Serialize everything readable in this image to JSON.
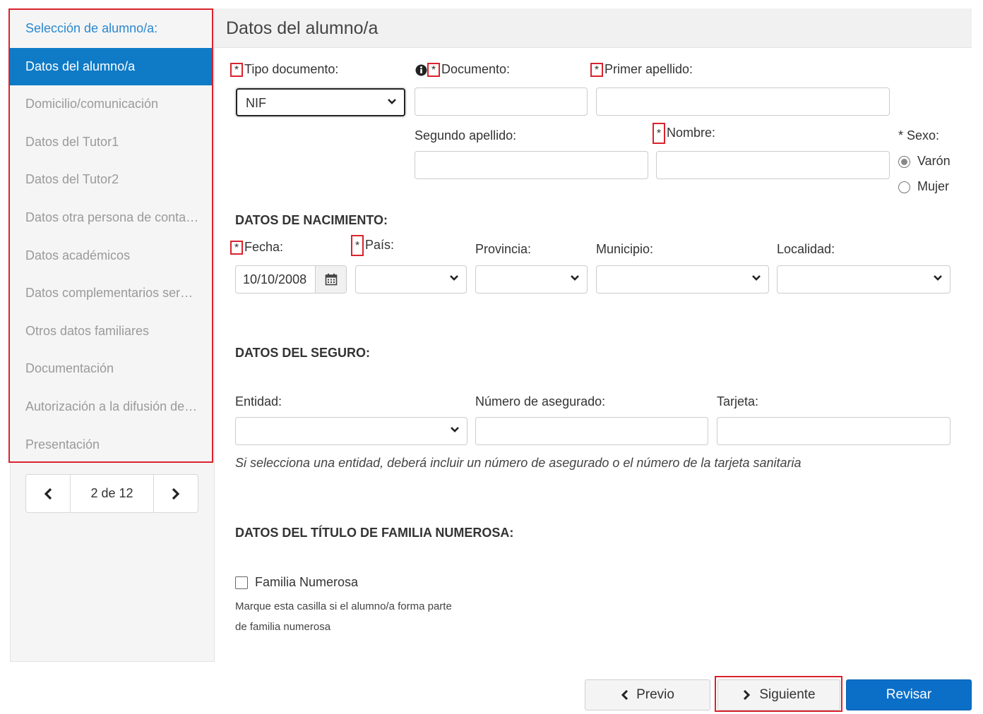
{
  "sidebar": {
    "items": [
      {
        "label": "Selección de alumno/a:",
        "state": "link"
      },
      {
        "label": "Datos del alumno/a",
        "state": "active"
      },
      {
        "label": "Domicilio/comunicación",
        "state": "disabled"
      },
      {
        "label": "Datos del Tutor1",
        "state": "disabled"
      },
      {
        "label": "Datos del Tutor2",
        "state": "disabled"
      },
      {
        "label": "Datos otra persona de contacto",
        "state": "disabled"
      },
      {
        "label": "Datos académicos",
        "state": "disabled"
      },
      {
        "label": "Datos complementarios servicios",
        "state": "disabled"
      },
      {
        "label": "Otros datos familiares",
        "state": "disabled"
      },
      {
        "label": "Documentación",
        "state": "disabled"
      },
      {
        "label": "Autorización a la difusión de imágenes",
        "state": "disabled"
      },
      {
        "label": "Presentación",
        "state": "disabled"
      }
    ]
  },
  "pager": {
    "text": "2 de 12"
  },
  "main": {
    "title": "Datos del alumno/a",
    "required_mark": "*",
    "identity": {
      "tipo_documento_label": "Tipo documento:",
      "tipo_documento_value": "NIF",
      "documento_label": "Documento:",
      "primer_apellido_label": "Primer apellido:",
      "segundo_apellido_label": "Segundo apellido:",
      "nombre_label": "Nombre:",
      "sexo_label": "* Sexo:",
      "sexo_options": [
        "Varón",
        "Mujer"
      ],
      "sexo_selected": "Varón"
    },
    "nacimiento": {
      "title": "DATOS DE NACIMIENTO:",
      "fecha_label": "Fecha:",
      "fecha_value": "10/10/2008",
      "pais_label": "País:",
      "provincia_label": "Provincia:",
      "municipio_label": "Municipio:",
      "localidad_label": "Localidad:"
    },
    "seguro": {
      "title": "DATOS DEL SEGURO:",
      "entidad_label": "Entidad:",
      "numero_label": "Número de asegurado:",
      "tarjeta_label": "Tarjeta:",
      "hint": "Si selecciona una entidad, deberá incluir un número de asegurado o el número de la tarjeta sanitaria"
    },
    "familia": {
      "title": "DATOS DEL TÍTULO DE FAMILIA NUMEROSA:",
      "checkbox_label": "Familia Numerosa",
      "help_line1": "Marque esta casilla si el alumno/a forma parte",
      "help_line2": "de familia numerosa"
    }
  },
  "footer": {
    "previo_label": "Previo",
    "siguiente_label": "Siguiente",
    "revisar_label": "Revisar"
  },
  "colors": {
    "accent": "#0f7ac6",
    "primary_button": "#0b6fc7",
    "highlight_box": "#d9232d"
  }
}
